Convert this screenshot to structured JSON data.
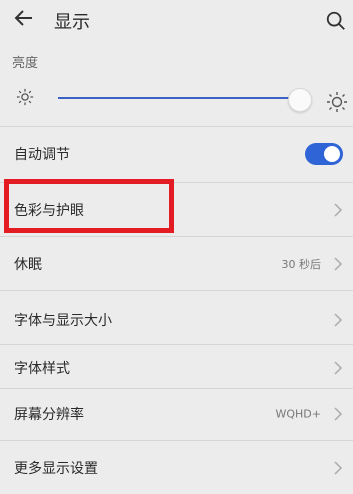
{
  "header": {
    "title": "显示"
  },
  "brightness": {
    "label": "亮度",
    "level": 0.97
  },
  "auto_adjust": {
    "label": "自动调节",
    "enabled": true
  },
  "rows": [
    {
      "label": "色彩与护眼",
      "value": ""
    },
    {
      "label": "休眠",
      "value": "30 秒后"
    },
    {
      "label": "字体与显示大小",
      "value": ""
    },
    {
      "label": "字体样式",
      "value": ""
    },
    {
      "label": "屏幕分辨率",
      "value": "WQHD+"
    },
    {
      "label": "更多显示设置",
      "value": ""
    }
  ],
  "colors": {
    "accent": "#2f64d6",
    "highlight": "#e31b23"
  }
}
